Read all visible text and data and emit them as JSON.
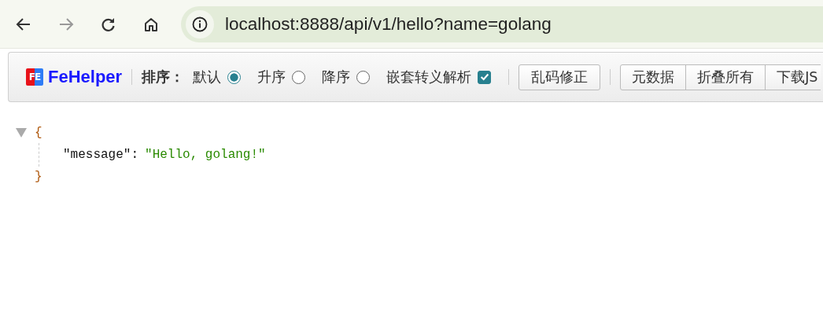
{
  "browser": {
    "url": "localhost:8888/api/v1/hello?name=golang"
  },
  "fehelper": {
    "logo_mark": "FE",
    "logo_text": "FeHelper",
    "sort_label": "排序：",
    "sort_options": [
      {
        "label": "默认",
        "selected": true
      },
      {
        "label": "升序",
        "selected": false
      },
      {
        "label": "降序",
        "selected": false
      }
    ],
    "nested_escape": {
      "label": "嵌套转义解析",
      "checked": true
    },
    "buttons": [
      "乱码修正"
    ],
    "button_group": [
      "元数据",
      "折叠所有",
      "下载JS"
    ]
  },
  "json_view": {
    "expanded": true,
    "open": "{",
    "entries": [
      {
        "key": "\"message\"",
        "separator": ":",
        "value": "\"Hello, golang!\""
      }
    ],
    "close": "}"
  }
}
